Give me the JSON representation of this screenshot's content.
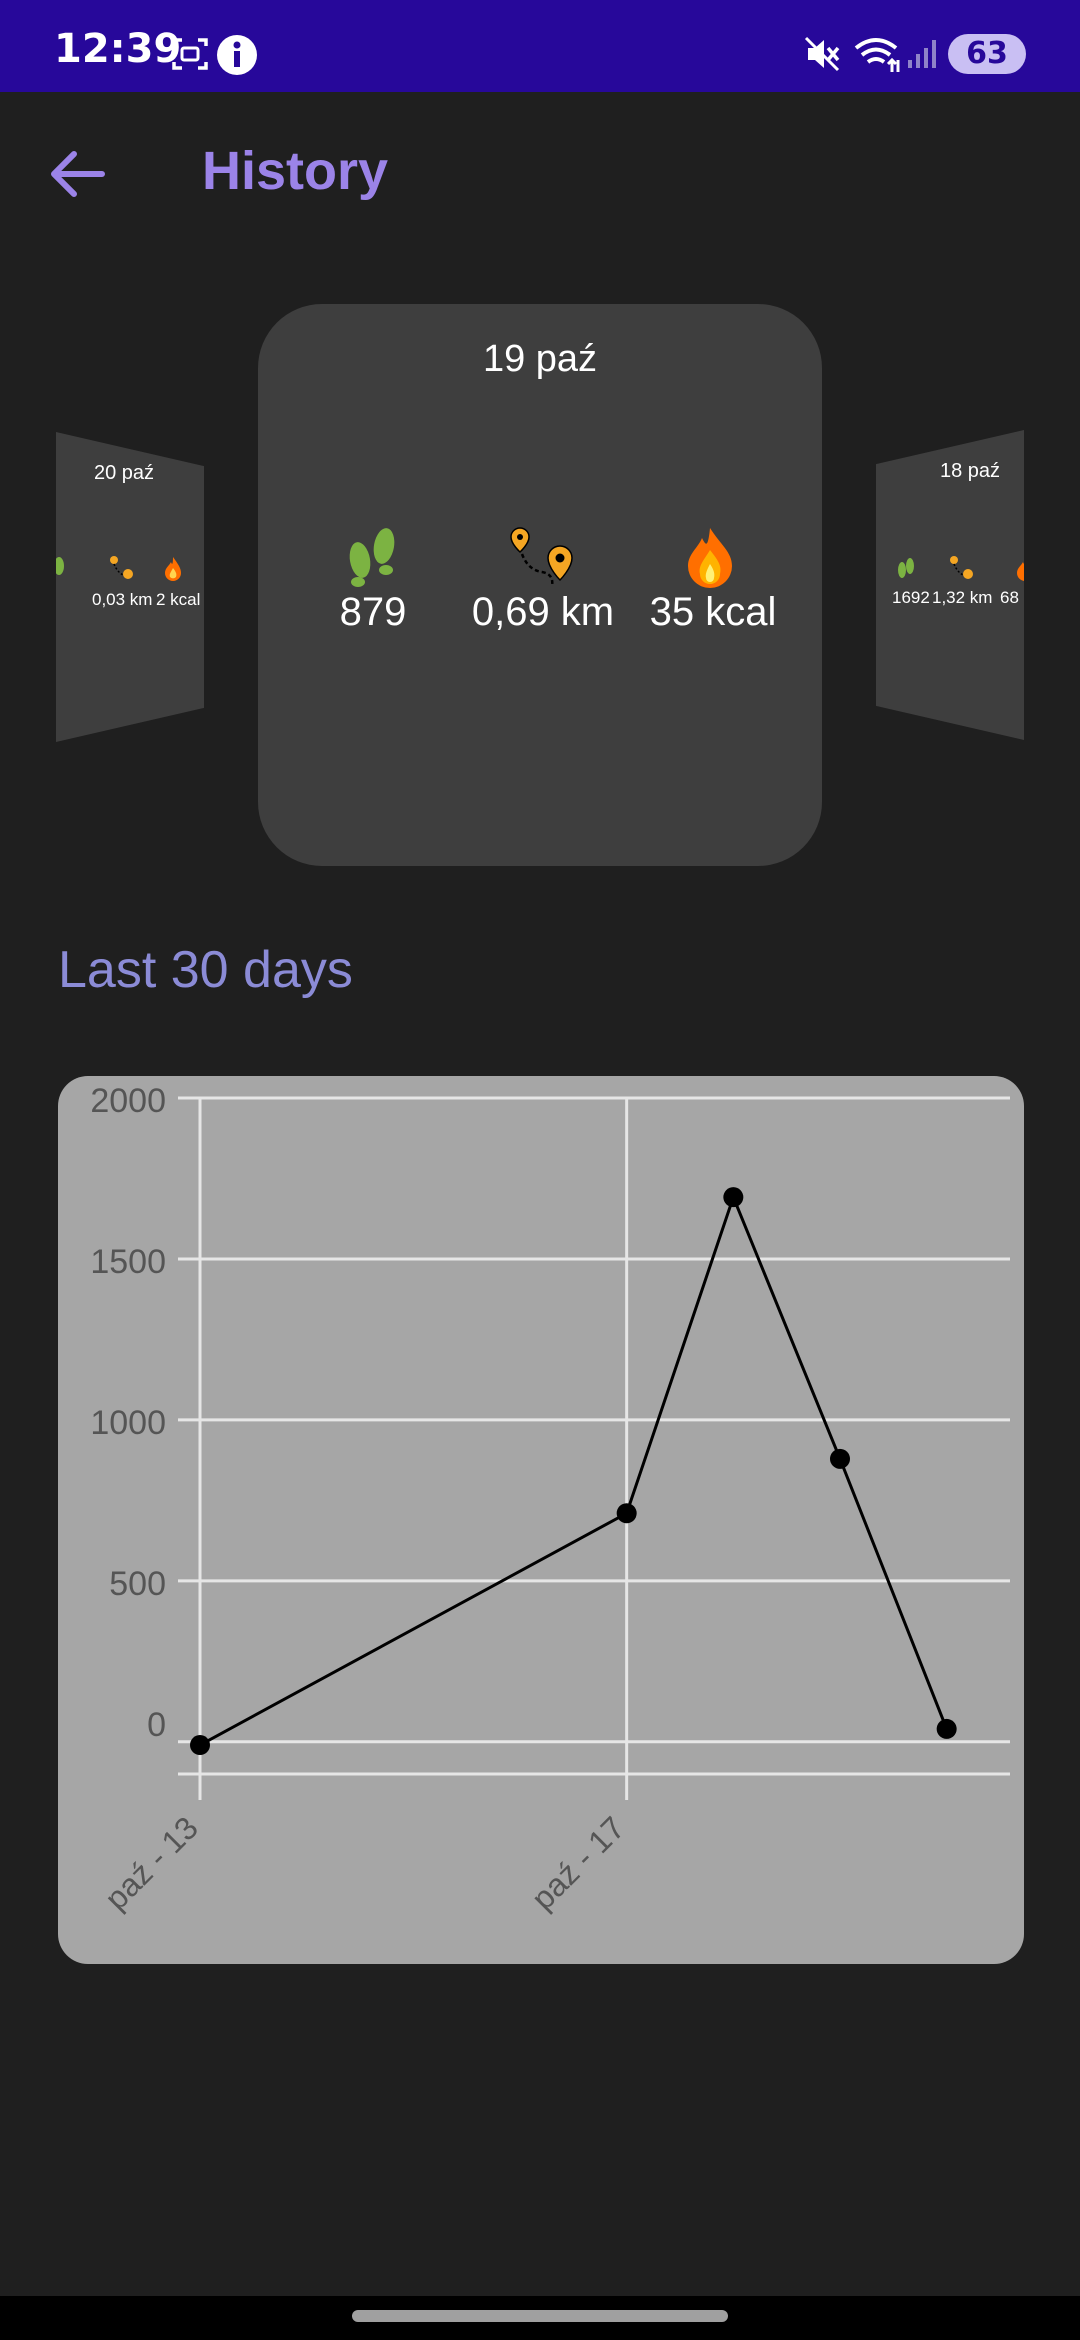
{
  "status_bar": {
    "time": "12:39",
    "battery": "63"
  },
  "header": {
    "title": "History"
  },
  "carousel": {
    "current": {
      "date": "19 paź",
      "steps": "879",
      "distance": "0,69 km",
      "calories": "35 kcal"
    },
    "previous": {
      "date": "20 paź",
      "distance": "0,03 km",
      "calories": "2 kcal"
    },
    "next": {
      "date": "18 paź",
      "steps": "1692",
      "distance": "1,32 km",
      "calories": "68"
    }
  },
  "section": {
    "title": "Last 30 days"
  },
  "colors": {
    "status_bar": "#27089a",
    "accent": "#9b83e8",
    "section_title": "#8b8bd6",
    "card": "#3e3e3e",
    "chart_bg": "#a6a6a6",
    "steps_icon": "#7cb342",
    "pin_icon": "#f5a623",
    "fire_icon": "#ff6f00"
  },
  "chart_data": {
    "type": "line",
    "x_ticks": [
      "paź - 13",
      "paź - 17"
    ],
    "y_ticks": [
      "0",
      "500",
      "1000",
      "1500",
      "2000"
    ],
    "ylim": [
      -100,
      2000
    ],
    "grid": true,
    "points": [
      {
        "day": 13,
        "value": -10
      },
      {
        "day": 17,
        "value": 710
      },
      {
        "day": 18,
        "value": 1692
      },
      {
        "day": 19,
        "value": 879
      },
      {
        "day": 20,
        "value": 40
      }
    ]
  }
}
